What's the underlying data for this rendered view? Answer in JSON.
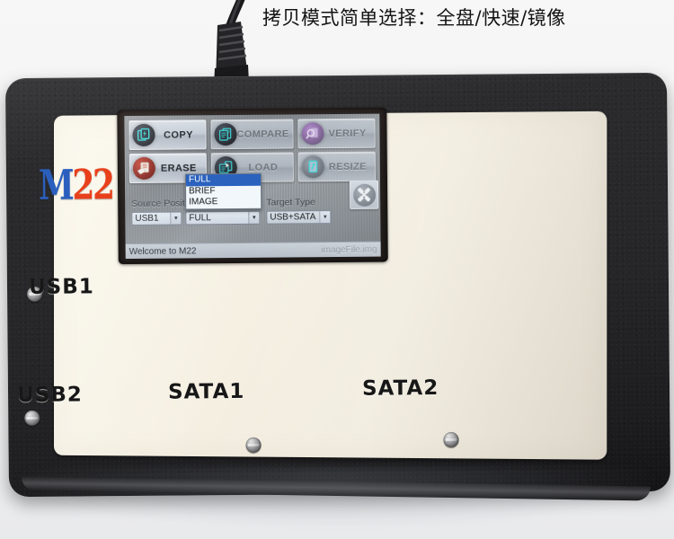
{
  "annotation": {
    "header_text": "拷贝模式简单选择：全盘/快速/镜像"
  },
  "device": {
    "brand_logo_primary": "M",
    "brand_logo_secondary": "22",
    "port_labels": [
      {
        "name": "usb1",
        "label": "USB1"
      },
      {
        "name": "usb2",
        "label": "USB2"
      },
      {
        "name": "sata1",
        "label": "SATA1"
      },
      {
        "name": "sata2",
        "label": "SATA2"
      }
    ]
  },
  "screen": {
    "function_buttons": [
      {
        "id": "copy",
        "label": "COPY",
        "icon": "copy-document-icon",
        "state": "active",
        "icon_color": "#2de0e0"
      },
      {
        "id": "compare",
        "label": "COMPARE",
        "icon": "compare-document-icon",
        "state": "disabled",
        "icon_color": "#2de0e0"
      },
      {
        "id": "verify",
        "label": "VERIFY",
        "icon": "verify-magnifier-icon",
        "state": "disabled",
        "icon_color": "#c9a4e4"
      },
      {
        "id": "erase",
        "label": "ERASE",
        "icon": "erase-document-icon",
        "state": "active",
        "icon_color": "#e8e0d8"
      },
      {
        "id": "load",
        "label": "LOAD",
        "icon": "load-folder-icon",
        "state": "disabled",
        "icon_color": "#2de0e0"
      },
      {
        "id": "resize",
        "label": "RESIZE",
        "icon": "resize-document-icon",
        "state": "disabled",
        "icon_color": "#2de0e0"
      }
    ],
    "source_position": {
      "label": "Source Position",
      "value": "USB1"
    },
    "copy_mode": {
      "value": "FULL",
      "options": [
        "FULL",
        "BRIEF",
        "IMAGE"
      ],
      "selected_option": "FULL",
      "expanded": true,
      "highlight_color": "#2a62be"
    },
    "target_type": {
      "label": "Target Type",
      "value": "USB+SATA"
    },
    "tool_button": {
      "icon": "wrench-icon"
    },
    "status_bar": {
      "message": "Welcome to M22",
      "image_file": "imageFile.img"
    }
  }
}
